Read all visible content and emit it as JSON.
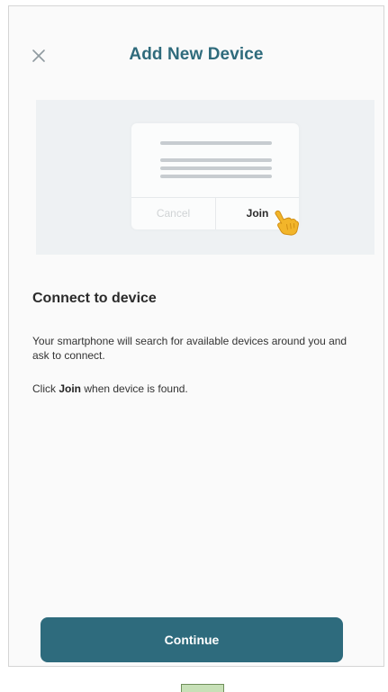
{
  "header": {
    "title": "Add New Device",
    "close_icon": "close-icon"
  },
  "illustration": {
    "dialog": {
      "cancel_label": "Cancel",
      "join_label": "Join"
    },
    "pointer_icon": "hand-pointer-icon"
  },
  "content": {
    "section_title": "Connect to device",
    "description": "Your smartphone will search for available devices around you and ask to connect.",
    "hint_prefix": "Click ",
    "hint_bold": "Join",
    "hint_suffix": " when device is found."
  },
  "footer": {
    "continue_label": "Continue"
  },
  "colors": {
    "accent": "#2e6b7d",
    "title": "#2f6b7c",
    "illustration_bg": "#eef1f3",
    "hand": "#f2b52a"
  }
}
